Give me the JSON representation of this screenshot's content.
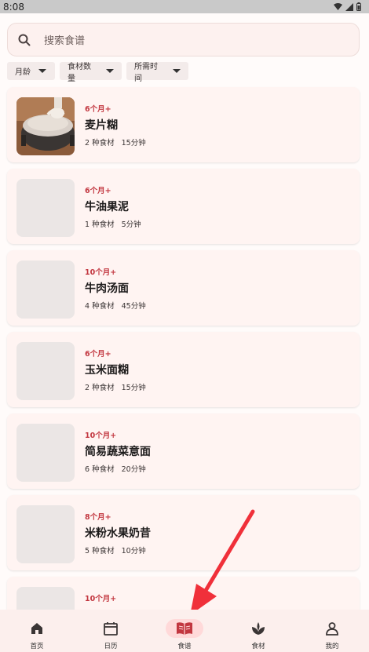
{
  "status": {
    "time": "8:08"
  },
  "search": {
    "placeholder": "搜索食谱"
  },
  "filters": [
    {
      "label": "月龄"
    },
    {
      "label": "食材数量"
    },
    {
      "label": "所需时间"
    }
  ],
  "recipes": [
    {
      "age": "6个月+",
      "name": "麦片糊",
      "ingredients": "2 种食材",
      "time": "15分钟"
    },
    {
      "age": "6个月+",
      "name": "牛油果泥",
      "ingredients": "1 种食材",
      "time": "5分钟"
    },
    {
      "age": "10个月+",
      "name": "牛肉汤面",
      "ingredients": "4 种食材",
      "time": "45分钟"
    },
    {
      "age": "6个月+",
      "name": "玉米面糊",
      "ingredients": "2 种食材",
      "time": "15分钟"
    },
    {
      "age": "10个月+",
      "name": "简易蔬菜意面",
      "ingredients": "6 种食材",
      "time": "20分钟"
    },
    {
      "age": "8个月+",
      "name": "米粉水果奶昔",
      "ingredients": "5 种食材",
      "time": "10分钟"
    },
    {
      "age": "10个月+"
    }
  ],
  "nav": [
    {
      "label": "首页",
      "icon": "home-icon"
    },
    {
      "label": "日历",
      "icon": "calendar-icon"
    },
    {
      "label": "食谱",
      "icon": "book-icon",
      "active": true
    },
    {
      "label": "食材",
      "icon": "sprout-icon"
    },
    {
      "label": "我的",
      "icon": "person-icon"
    }
  ],
  "colors": {
    "accent": "#c2363f",
    "arrow": "#f0303a",
    "active_pill": "#ffd9d9"
  }
}
